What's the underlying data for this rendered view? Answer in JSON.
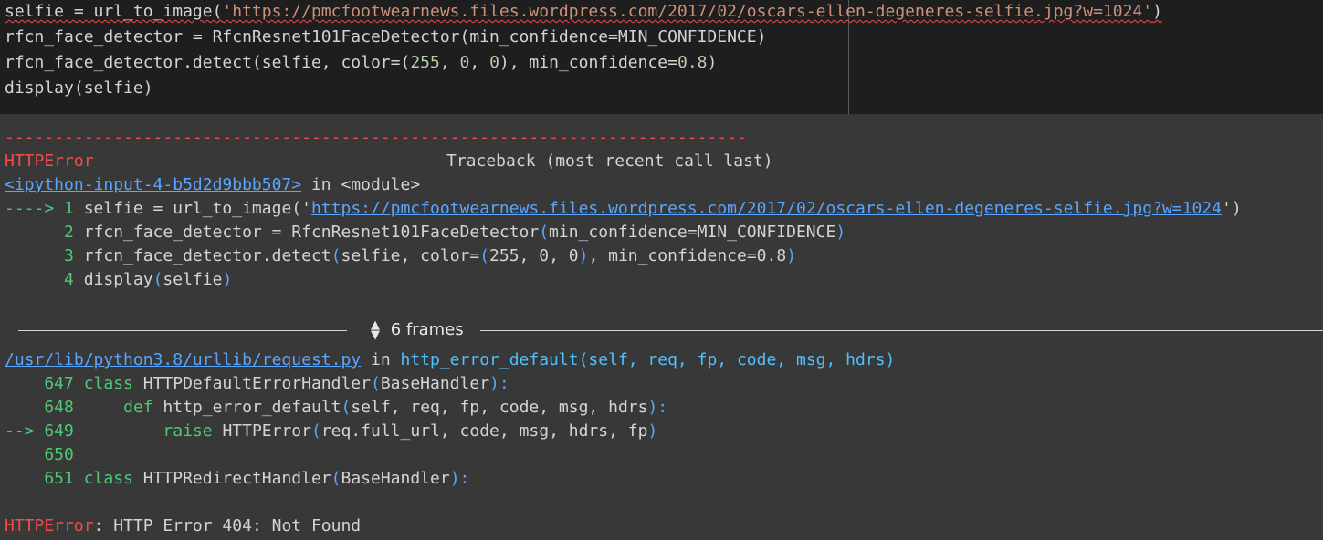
{
  "code_cell": {
    "line1": {
      "a": "selfie = url_to_image(",
      "b": "'https://pmcfootwearnews.files.wordpress.com/2017/02/oscars-ellen-degeneres-selfie.jpg?w=1024'",
      "c": ")"
    },
    "line2": {
      "a": "rfcn_face_detector = RfcnResnet101FaceDetector(min_confidence=MIN_CONFIDENCE)"
    },
    "line3": {
      "a": "rfcn_face_detector.detect(selfie, color=(",
      "n1": "255",
      "s1": ", ",
      "n2": "0",
      "s2": ", ",
      "n3": "0",
      "s3": "), min_confidence=",
      "n4": "0.8",
      "s4": ")"
    },
    "line4": {
      "a": "display(selfie)"
    }
  },
  "output": {
    "dashes": "---------------------------------------------------------------------------",
    "error_name": "HTTPError",
    "traceback_header": "Traceback (most recent call last)",
    "input_link": "<ipython-input-4-b5d2d9bbb507>",
    "in_module": " in <module>",
    "tb1": {
      "arrow": "----> 1 ",
      "code_a": "selfie = url_to_image(",
      "quote_open": "'",
      "url": "https://pmcfootwearnews.files.wordpress.com/2017/02/oscars-ellen-degeneres-selfie.jpg?w=1024",
      "quote_close": "'",
      "close": ")"
    },
    "tb2": {
      "num": "      2 ",
      "code_a": "rfcn_face_detector = RfcnResnet101FaceDetector",
      "paren_open": "(",
      "code_b": "min_confidence=MIN_CONFIDENCE",
      "paren_close": ")"
    },
    "tb3": {
      "num": "      3 ",
      "code_a": "rfcn_face_detector.detect",
      "p1": "(",
      "code_b": "selfie, color=",
      "p2": "(",
      "code_c": "255, 0, 0",
      "p3": ")",
      "code_d": ", min_confidence=0.8",
      "p4": ")"
    },
    "tb4": {
      "num": "      4 ",
      "code_a": "display",
      "p1": "(",
      "code_b": "selfie",
      "p2": ")"
    },
    "frames_label": "6 frames",
    "file_link": "/usr/lib/python3.8/urllib/request.py",
    "file_in": " in ",
    "file_func": "http_error_default(self, req, fp, code, msg, hdrs)",
    "f647": {
      "num": "    647 ",
      "kw": "class ",
      "name": "HTTPDefaultErrorHandler",
      "p1": "(",
      "base": "BaseHandler",
      "p2": "):"
    },
    "f648": {
      "num": "    648 ",
      "indent": "    ",
      "kw": "def ",
      "name": "http_error_default",
      "p1": "(",
      "args": "self, req, fp, code, msg, hdrs",
      "p2": "):"
    },
    "f649": {
      "arrow": "--> 649 ",
      "indent": "        ",
      "kw": "raise ",
      "name": "HTTPError",
      "p1": "(",
      "args": "req.full_url, code, msg, hdrs, fp",
      "p2": ")"
    },
    "f650": {
      "num": "    650"
    },
    "f651": {
      "num": "    651 ",
      "kw": "class ",
      "name": "HTTPRedirectHandler",
      "p1": "(",
      "base": "BaseHandler",
      "p2": "):"
    },
    "final_error_name": "HTTPError",
    "final_error_msg": ": HTTP Error 404: Not Found"
  },
  "colors": {
    "code_bg": "#1e1e1e",
    "output_bg": "#383838",
    "error_red": "#f14c4c",
    "lineno_green": "#4ec975",
    "link_blue": "#58a6ff"
  },
  "icons": {
    "frames_toggle": "unfold-chevrons-icon"
  }
}
